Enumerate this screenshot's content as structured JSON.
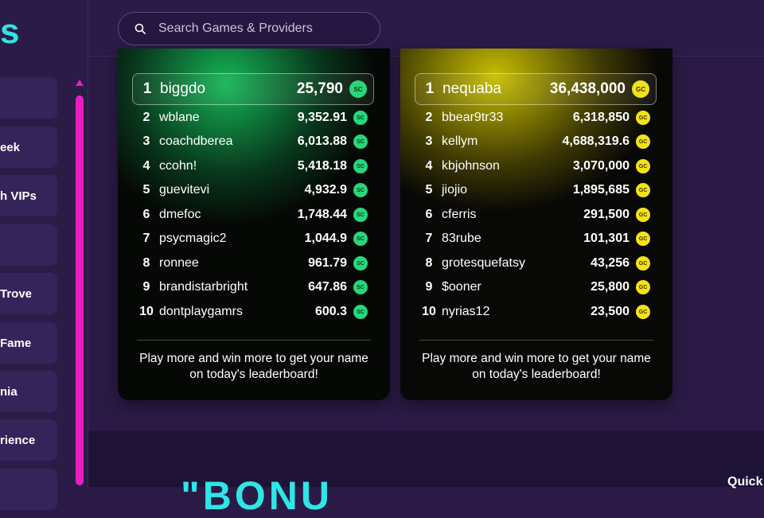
{
  "logo": {
    "text": "s"
  },
  "sidebar": {
    "items": [
      {
        "label": ""
      },
      {
        "label": "eek"
      },
      {
        "label": "h VIPs"
      },
      {
        "label": ""
      },
      {
        "label": "Trove"
      },
      {
        "label": "Fame"
      },
      {
        "label": "nia"
      },
      {
        "label": "rience"
      },
      {
        "label": ""
      }
    ]
  },
  "search": {
    "placeholder": "Search Games & Providers"
  },
  "leaderboards": [
    {
      "coin": "SC",
      "coin_color": "#29d67a",
      "entries": [
        {
          "rank": "1",
          "name": "biggdo",
          "amount": "25,790"
        },
        {
          "rank": "2",
          "name": "wblane",
          "amount": "9,352.91"
        },
        {
          "rank": "3",
          "name": "coachdberea",
          "amount": "6,013.88"
        },
        {
          "rank": "4",
          "name": "ccohn!",
          "amount": "5,418.18"
        },
        {
          "rank": "5",
          "name": "guevitevi",
          "amount": "4,932.9"
        },
        {
          "rank": "6",
          "name": "dmefoc",
          "amount": "1,748.44"
        },
        {
          "rank": "7",
          "name": "psycmagic2",
          "amount": "1,044.9"
        },
        {
          "rank": "8",
          "name": "ronnee",
          "amount": "961.79"
        },
        {
          "rank": "9",
          "name": "brandistarbright",
          "amount": "647.86"
        },
        {
          "rank": "10",
          "name": "dontplaygamrs",
          "amount": "600.3"
        }
      ],
      "cta": "Play more and win more to get your name on today's leaderboard!"
    },
    {
      "coin": "GC",
      "coin_color": "#f2e21a",
      "entries": [
        {
          "rank": "1",
          "name": "nequaba",
          "amount": "36,438,000"
        },
        {
          "rank": "2",
          "name": "bbear9tr33",
          "amount": "6,318,850"
        },
        {
          "rank": "3",
          "name": "kellym",
          "amount": "4,688,319.6"
        },
        {
          "rank": "4",
          "name": "kbjohnson",
          "amount": "3,070,000"
        },
        {
          "rank": "5",
          "name": "jiojio",
          "amount": "1,895,685"
        },
        {
          "rank": "6",
          "name": "cferris",
          "amount": "291,500"
        },
        {
          "rank": "7",
          "name": "83rube",
          "amount": "101,301"
        },
        {
          "rank": "8",
          "name": "grotesquefatsy",
          "amount": "43,256"
        },
        {
          "rank": "9",
          "name": "$ooner",
          "amount": "25,800"
        },
        {
          "rank": "10",
          "name": "nyrias12",
          "amount": "23,500"
        }
      ],
      "cta": "Play more and win more to get your name on today's leaderboard!"
    }
  ],
  "lower": {
    "banner_text": "\"BONU",
    "quick_label": "Quick"
  }
}
